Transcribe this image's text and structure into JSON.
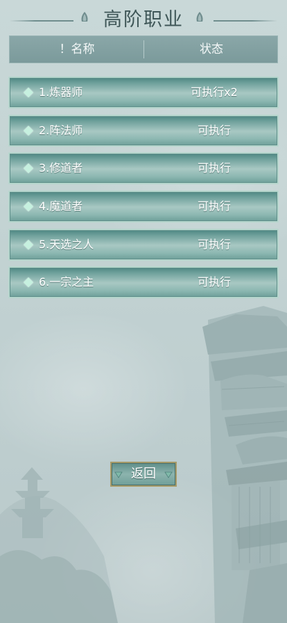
{
  "title": "高阶职业",
  "header": {
    "name_label": "！名称",
    "status_label": "状态"
  },
  "rows": [
    {
      "name": "1.炼器师",
      "status": "可执行x2"
    },
    {
      "name": "2.阵法师",
      "status": "可执行"
    },
    {
      "name": "3.修道者",
      "status": "可执行"
    },
    {
      "name": "4.魔道者",
      "status": "可执行"
    },
    {
      "name": "5.天选之人",
      "status": "可执行"
    },
    {
      "name": "6.一宗之主",
      "status": "可执行"
    }
  ],
  "back_label": "返回",
  "icons": {
    "title_ornament": "lotus-ornament-icon",
    "row_marker": "diamond-icon",
    "button_ornament": "gem-ornament-icon"
  },
  "colors": {
    "title": "#3f5758",
    "row_border": "#b6d6cd",
    "diamond": "#c6f0df",
    "button_border": "#a79b68"
  }
}
